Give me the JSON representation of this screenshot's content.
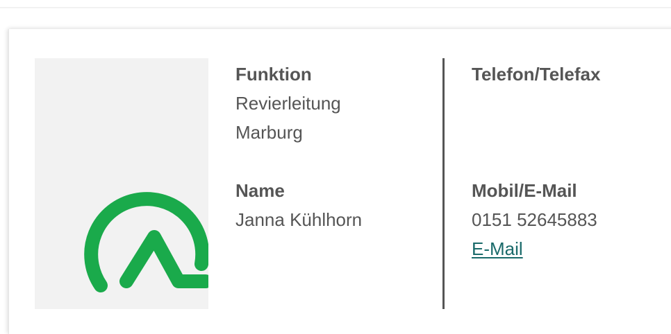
{
  "contact": {
    "funktion_label": "Funktion",
    "funktion_value_line1": "Revierleitung",
    "funktion_value_line2": "Marburg",
    "name_label": "Name",
    "name_value": "Janna Kühlhorn",
    "telefon_label": "Telefon/Telefax",
    "mobil_label": "Mobil/E-Mail",
    "mobil_value": "0151 52645883",
    "email_link": "E-Mail"
  },
  "logo": {
    "icon": "green-arc-logo-icon",
    "color": "#1aaa4b"
  },
  "colors": {
    "text": "#555555",
    "link": "#1a6a6a",
    "image_bg": "#f2f2f2"
  }
}
